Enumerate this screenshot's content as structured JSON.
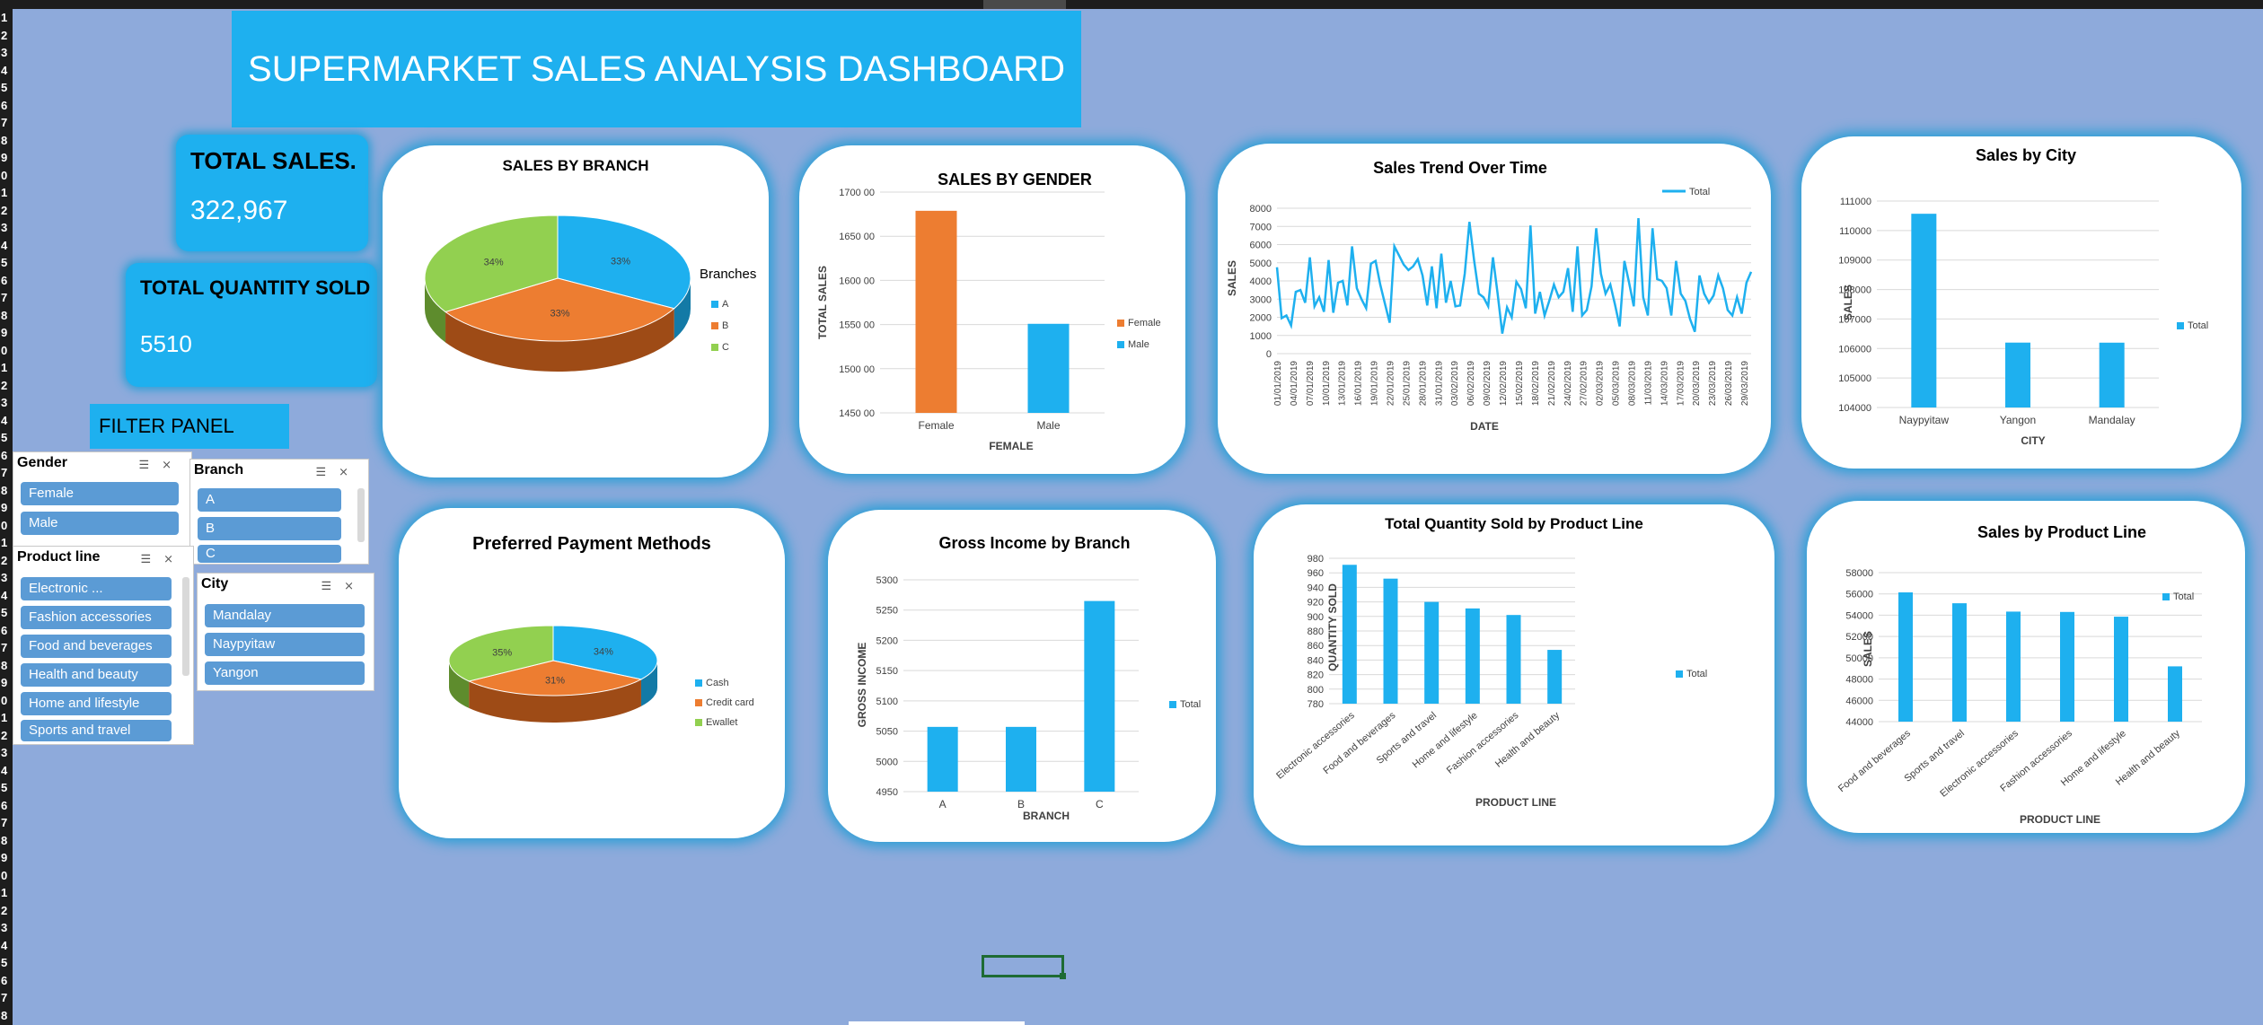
{
  "title": "SUPERMARKET SALES ANALYSIS DASHBOARD",
  "kpis": {
    "total_sales_label": "TOTAL SALES.",
    "total_sales_value": "322,967",
    "total_qty_label": "TOTAL QUANTITY SOLD",
    "total_qty_value": "5510"
  },
  "filter_panel": "FILTER PANEL",
  "row_numbers": [
    "1",
    "2",
    "3",
    "4",
    "5",
    "6",
    "7",
    "8",
    "9",
    "0",
    "1",
    "2",
    "3",
    "4",
    "5",
    "6",
    "7",
    "8",
    "9",
    "0",
    "1",
    "2",
    "3",
    "4",
    "5",
    "6",
    "7",
    "8",
    "9",
    "0",
    "1",
    "2",
    "3",
    "4",
    "5",
    "6",
    "7",
    "8",
    "9",
    "0",
    "1",
    "2",
    "3",
    "4",
    "5",
    "6",
    "7",
    "8",
    "9",
    "0",
    "1",
    "2",
    "3",
    "4",
    "5",
    "6",
    "7",
    "8"
  ],
  "slicers": {
    "gender": {
      "title": "Gender",
      "items": [
        "Female",
        "Male"
      ]
    },
    "branch": {
      "title": "Branch",
      "items": [
        "A",
        "B",
        "C"
      ]
    },
    "product_line": {
      "title": "Product line",
      "items": [
        "Electronic ...",
        "Fashion accessories",
        "Food and beverages",
        "Health and beauty",
        "Home and lifestyle",
        "Sports and travel"
      ]
    },
    "city": {
      "title": "City",
      "items": [
        "Mandalay",
        "Naypyitaw",
        "Yangon"
      ]
    }
  },
  "colors": {
    "blue": "#1eb0ef",
    "orange": "#ed7d31",
    "green": "#92d050",
    "page": "#8eaadb"
  },
  "chart_data": [
    {
      "id": "branch_pie",
      "type": "pie",
      "title": "SALES BY BRANCH",
      "legend_title": "Branches",
      "categories": [
        "A",
        "B",
        "C"
      ],
      "values": [
        33,
        33,
        34
      ],
      "labels": [
        "33%",
        "33%",
        "34%"
      ]
    },
    {
      "id": "gender_bar",
      "type": "bar",
      "title": "SALES BY GENDER",
      "categories": [
        "Female",
        "Male"
      ],
      "values": [
        167880,
        155084
      ],
      "ylim": [
        145000,
        170000
      ],
      "yticks": [
        145000,
        150000,
        155000,
        160000,
        165000,
        170000
      ],
      "ytick_labels": [
        "1450 00",
        "1500 00",
        "1550 00",
        "1600 00",
        "1650 00",
        "1700 00"
      ],
      "ylabel": "TOTAL SALES",
      "xlabel": "FEMALE",
      "legend": [
        "Female",
        "Male"
      ]
    },
    {
      "id": "trend_line",
      "type": "line",
      "title": "Sales Trend Over Time",
      "legend": [
        "Total"
      ],
      "ylabel": "SALES",
      "xlabel": "DATE",
      "ylim": [
        0,
        8000
      ],
      "yticks": [
        0,
        1000,
        2000,
        3000,
        4000,
        5000,
        6000,
        7000,
        8000
      ],
      "ytick_labels": [
        "0",
        "1000",
        "2000",
        "3000",
        "4000",
        "5000",
        "6000",
        "7000",
        "8000"
      ],
      "x_tick_labels": [
        "01/01/2019",
        "04/01/2019",
        "07/01/2019",
        "10/01/2019",
        "13/01/2019",
        "16/01/2019",
        "19/01/2019",
        "22/01/2019",
        "25/01/2019",
        "28/01/2019",
        "31/01/2019",
        "03/02/2019",
        "06/02/2019",
        "09/02/2019",
        "12/02/2019",
        "15/02/2019",
        "18/02/2019",
        "21/02/2019",
        "24/02/2019",
        "27/02/2019",
        "02/03/2019",
        "05/03/2019",
        "08/03/2019",
        "11/03/2019",
        "14/03/2019",
        "17/03/2019",
        "20/03/2019",
        "23/03/2019",
        "26/03/2019",
        "29/03/2019"
      ],
      "values": [
        4750,
        1950,
        2100,
        1550,
        3400,
        3500,
        2800,
        5300,
        2600,
        3100,
        2300,
        5150,
        2250,
        3900,
        4000,
        2650,
        5900,
        3600,
        3000,
        2500,
        4950,
        5100,
        3800,
        2750,
        1700,
        5900,
        5400,
        4900,
        4600,
        4800,
        5200,
        4300,
        2650,
        4800,
        2500,
        5500,
        2800,
        4000,
        2600,
        2650,
        4400,
        7250,
        5100,
        3300,
        3100,
        2600,
        5300,
        3300,
        1100,
        2550,
        2000,
        3950,
        3550,
        2500,
        7050,
        2200,
        3400,
        2100,
        2900,
        3800,
        3100,
        3400,
        4700,
        2300,
        5900,
        2100,
        2400,
        3700,
        6900,
        4400,
        3300,
        3800,
        2700,
        1500,
        5100,
        3900,
        2600,
        7450,
        3100,
        2100,
        6900,
        4100,
        4000,
        3600,
        2100,
        5100,
        3300,
        2900,
        1900,
        1200,
        4300,
        3300,
        2800,
        3200,
        4300,
        3600,
        2400,
        2100,
        3100,
        2200,
        3900,
        4500
      ]
    },
    {
      "id": "city_bar",
      "type": "bar",
      "title": "Sales by City",
      "categories": [
        "Naypyitaw",
        "Yangon",
        "Mandalay"
      ],
      "values": [
        110569,
        106200,
        106198
      ],
      "ylim": [
        104000,
        111000
      ],
      "yticks": [
        104000,
        105000,
        106000,
        107000,
        108000,
        109000,
        110000,
        111000
      ],
      "ytick_labels": [
        "104000",
        "105000",
        "106000",
        "107000",
        "108000",
        "109000",
        "110000",
        "111000"
      ],
      "ylabel": "SALES",
      "xlabel": "CITY",
      "legend": [
        "Total"
      ]
    },
    {
      "id": "payment_pie",
      "type": "pie",
      "title": "Preferred Payment Methods",
      "categories": [
        "Cash",
        "Credit card",
        "Ewallet"
      ],
      "values": [
        34,
        31,
        35
      ],
      "labels": [
        "34%",
        "31%",
        "35%"
      ]
    },
    {
      "id": "income_bar",
      "type": "bar",
      "title": "Gross Income by Branch",
      "categories": [
        "A",
        "B",
        "C"
      ],
      "values": [
        5057,
        5057,
        5265
      ],
      "ylim": [
        4950,
        5300
      ],
      "yticks": [
        4950,
        5000,
        5050,
        5100,
        5150,
        5200,
        5250,
        5300
      ],
      "ytick_labels": [
        "4950",
        "5000",
        "5050",
        "5100",
        "5150",
        "5200",
        "5250",
        "5300"
      ],
      "ylabel": "GROSS INCOME",
      "xlabel": "BRANCH",
      "legend": [
        "Total"
      ]
    },
    {
      "id": "qty_bar",
      "type": "bar",
      "title": "Total Quantity Sold by Product Line",
      "categories": [
        "Electronic accessories",
        "Food and beverages",
        "Sports and travel",
        "Home and lifestyle",
        "Fashion accessories",
        "Health and beauty"
      ],
      "values": [
        971,
        952,
        920,
        911,
        902,
        854
      ],
      "ylim": [
        780,
        980
      ],
      "yticks": [
        780,
        800,
        820,
        840,
        860,
        880,
        900,
        920,
        940,
        960,
        980
      ],
      "ytick_labels": [
        "780",
        "800",
        "820",
        "840",
        "860",
        "880",
        "900",
        "920",
        "940",
        "960",
        "980"
      ],
      "ylabel": "QUANTITY SOLD",
      "xlabel": "PRODUCT LINE",
      "legend": [
        "Total"
      ]
    },
    {
      "id": "pl_sales_bar",
      "type": "bar",
      "title": "Sales by Product Line",
      "categories": [
        "Food and beverages",
        "Sports and travel",
        "Electronic accessories",
        "Fashion accessories",
        "Home and lifestyle",
        "Health and beauty"
      ],
      "values": [
        56145,
        55123,
        54338,
        54306,
        53862,
        49194
      ],
      "ylim": [
        44000,
        58000
      ],
      "yticks": [
        44000,
        46000,
        48000,
        50000,
        52000,
        54000,
        56000,
        58000
      ],
      "ytick_labels": [
        "44000",
        "46000",
        "48000",
        "50000",
        "52000",
        "54000",
        "56000",
        "58000"
      ],
      "ylabel": "SALES",
      "xlabel": "PRODUCT LINE",
      "legend": [
        "Total"
      ]
    }
  ]
}
